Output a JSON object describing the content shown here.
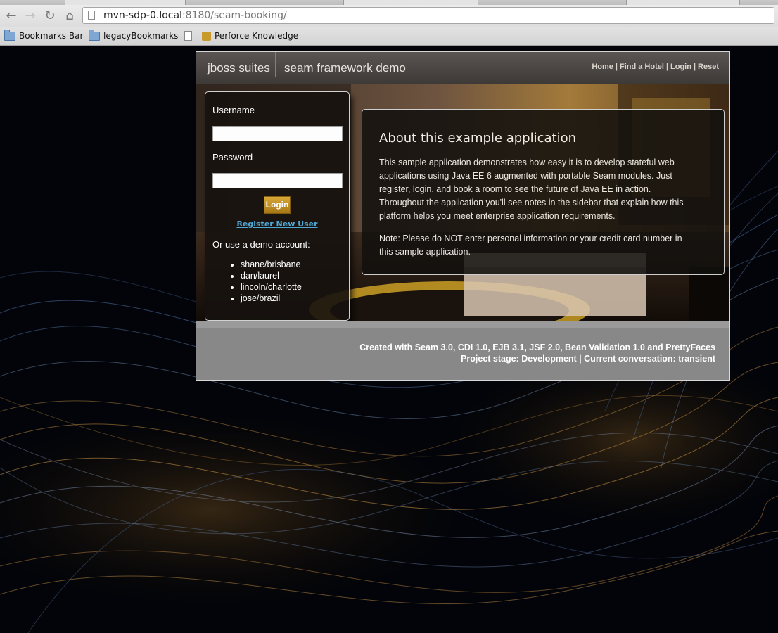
{
  "browser": {
    "url_host": "mvn-sdp-0.local",
    "url_rest": ":8180/seam-booking/",
    "bookmarks": [
      {
        "label": "Bookmarks Bar",
        "icon": "folder-icon"
      },
      {
        "label": "legacyBookmarks",
        "icon": "folder-icon"
      },
      {
        "label": "",
        "icon": "page-icon"
      },
      {
        "label": "Perforce Knowledge",
        "icon": "perforce-icon"
      }
    ]
  },
  "app": {
    "brand": "jboss suites",
    "subtitle": "seam framework demo",
    "nav": {
      "home": "Home",
      "find_hotel": "Find a Hotel",
      "login": "Login",
      "reset": "Reset",
      "separator": "|"
    }
  },
  "login": {
    "username_label": "Username",
    "username_value": "",
    "password_label": "Password",
    "password_value": "",
    "button_label": "Login",
    "register_link": "Register New User",
    "demo_title": "Or use a demo account:",
    "demo_accounts": [
      "shane/brisbane",
      "dan/laurel",
      "lincoln/charlotte",
      "jose/brazil"
    ]
  },
  "about": {
    "title": "About this example application",
    "paragraph1": "This sample application demonstrates how easy it is to develop stateful web applications using Java EE 6 augmented with portable Seam modules. Just register, login, and book a room to see the future of Java EE in action. Throughout the application you'll see notes in the sidebar that explain how this platform helps you meet enterprise application requirements.",
    "paragraph2": "Note: Please do NOT enter personal information or your credit card number in this sample application."
  },
  "footer": {
    "line1": "Created with Seam 3.0, CDI 1.0, EJB 3.1, JSF 2.0, Bean Validation 1.0 and PrettyFaces",
    "line2": "Project stage: Development | Current conversation: transient"
  },
  "colors": {
    "accent_button": "#c08f25",
    "link": "#4fa8d6",
    "header_bg": "#4a4542",
    "footer_bg": "#888888"
  }
}
